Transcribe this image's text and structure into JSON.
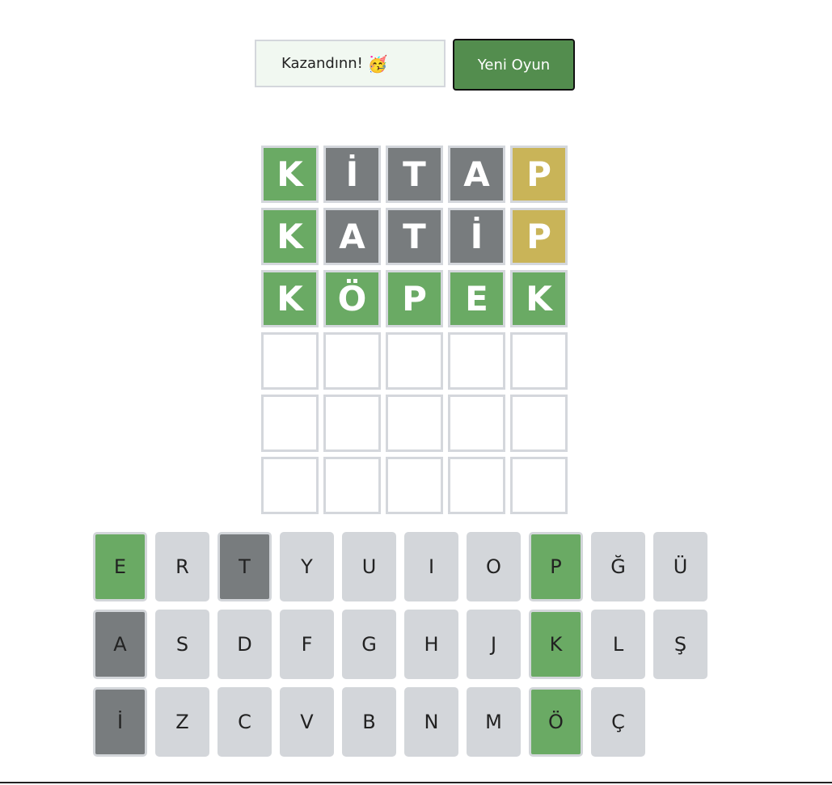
{
  "status": {
    "message": "Kazandınn!",
    "emoji": "🥳"
  },
  "new_game_label": "Yeni Oyun",
  "colors": {
    "correct": "#6aaa64",
    "absent": "#787c7e",
    "present": "#c9b458",
    "key_default": "#d3d6da",
    "button": "#538d4e"
  },
  "board": {
    "rows": [
      [
        {
          "letter": "K",
          "state": "correct"
        },
        {
          "letter": "İ",
          "state": "absent"
        },
        {
          "letter": "T",
          "state": "absent"
        },
        {
          "letter": "A",
          "state": "absent"
        },
        {
          "letter": "P",
          "state": "present"
        }
      ],
      [
        {
          "letter": "K",
          "state": "correct"
        },
        {
          "letter": "A",
          "state": "absent"
        },
        {
          "letter": "T",
          "state": "absent"
        },
        {
          "letter": "İ",
          "state": "absent"
        },
        {
          "letter": "P",
          "state": "present"
        }
      ],
      [
        {
          "letter": "K",
          "state": "correct"
        },
        {
          "letter": "Ö",
          "state": "correct"
        },
        {
          "letter": "P",
          "state": "correct"
        },
        {
          "letter": "E",
          "state": "correct"
        },
        {
          "letter": "K",
          "state": "correct"
        }
      ],
      [
        {
          "letter": "",
          "state": "empty"
        },
        {
          "letter": "",
          "state": "empty"
        },
        {
          "letter": "",
          "state": "empty"
        },
        {
          "letter": "",
          "state": "empty"
        },
        {
          "letter": "",
          "state": "empty"
        }
      ],
      [
        {
          "letter": "",
          "state": "empty"
        },
        {
          "letter": "",
          "state": "empty"
        },
        {
          "letter": "",
          "state": "empty"
        },
        {
          "letter": "",
          "state": "empty"
        },
        {
          "letter": "",
          "state": "empty"
        }
      ],
      [
        {
          "letter": "",
          "state": "empty"
        },
        {
          "letter": "",
          "state": "empty"
        },
        {
          "letter": "",
          "state": "empty"
        },
        {
          "letter": "",
          "state": "empty"
        },
        {
          "letter": "",
          "state": "empty"
        }
      ]
    ]
  },
  "keyboard": {
    "rows": [
      [
        {
          "key": "E",
          "state": "correct"
        },
        {
          "key": "R",
          "state": "default"
        },
        {
          "key": "T",
          "state": "absent"
        },
        {
          "key": "Y",
          "state": "default"
        },
        {
          "key": "U",
          "state": "default"
        },
        {
          "key": "I",
          "state": "default"
        },
        {
          "key": "O",
          "state": "default"
        },
        {
          "key": "P",
          "state": "correct"
        },
        {
          "key": "Ğ",
          "state": "default"
        },
        {
          "key": "Ü",
          "state": "default"
        }
      ],
      [
        {
          "key": "A",
          "state": "absent"
        },
        {
          "key": "S",
          "state": "default"
        },
        {
          "key": "D",
          "state": "default"
        },
        {
          "key": "F",
          "state": "default"
        },
        {
          "key": "G",
          "state": "default"
        },
        {
          "key": "H",
          "state": "default"
        },
        {
          "key": "J",
          "state": "default"
        },
        {
          "key": "K",
          "state": "correct"
        },
        {
          "key": "L",
          "state": "default"
        },
        {
          "key": "Ş",
          "state": "default"
        }
      ],
      [
        {
          "key": "İ",
          "state": "absent"
        },
        {
          "key": "Z",
          "state": "default"
        },
        {
          "key": "C",
          "state": "default"
        },
        {
          "key": "V",
          "state": "default"
        },
        {
          "key": "B",
          "state": "default"
        },
        {
          "key": "N",
          "state": "default"
        },
        {
          "key": "M",
          "state": "default"
        },
        {
          "key": "Ö",
          "state": "correct"
        },
        {
          "key": "Ç",
          "state": "default"
        }
      ]
    ]
  }
}
